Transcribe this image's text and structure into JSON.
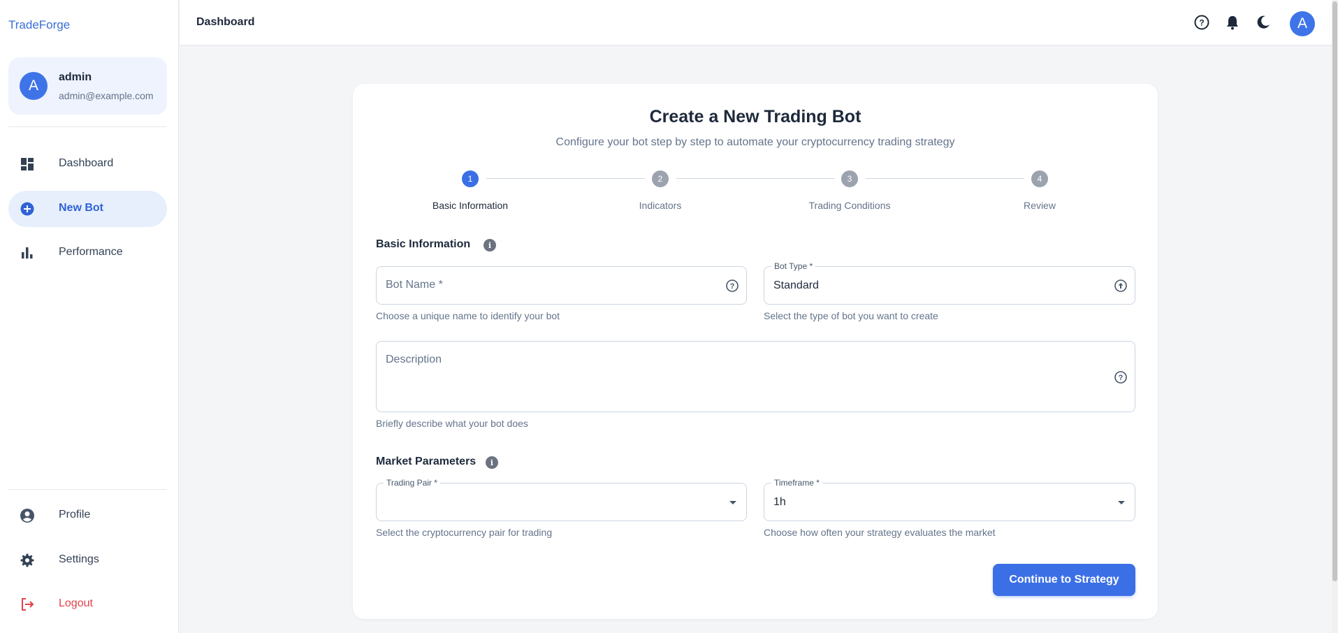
{
  "app": {
    "brand": "TradeForge"
  },
  "user": {
    "avatar_letter": "A",
    "name": "admin",
    "email": "admin@example.com"
  },
  "sidebar": {
    "items": [
      {
        "label": "Dashboard",
        "icon": "dashboard-icon"
      },
      {
        "label": "New Bot",
        "icon": "add-circle-icon",
        "active": true
      },
      {
        "label": "Performance",
        "icon": "bar-chart-icon"
      }
    ],
    "bottom_items": [
      {
        "label": "Profile",
        "icon": "account-circle-icon"
      },
      {
        "label": "Settings",
        "icon": "gear-icon"
      },
      {
        "label": "Logout",
        "icon": "logout-icon"
      }
    ]
  },
  "header": {
    "title": "Dashboard",
    "icons": [
      "help-icon",
      "bell-icon",
      "moon-icon"
    ],
    "avatar_letter": "A"
  },
  "wizard": {
    "title": "Create a New Trading Bot",
    "subtitle": "Configure your bot step by step to automate your cryptocurrency trading strategy",
    "steps": [
      {
        "number": "1",
        "label": "Basic Information",
        "active": true
      },
      {
        "number": "2",
        "label": "Indicators"
      },
      {
        "number": "3",
        "label": "Trading Conditions"
      },
      {
        "number": "4",
        "label": "Review"
      }
    ]
  },
  "basic_info": {
    "section_title": "Basic Information",
    "bot_name": {
      "placeholder": "Bot Name *",
      "value": "",
      "helper": "Choose a unique name to identify your bot"
    },
    "bot_type": {
      "label": "Bot Type *",
      "value": "Standard",
      "helper": "Select the type of bot you want to create"
    },
    "description": {
      "placeholder": "Description",
      "value": "",
      "helper": "Briefly describe what your bot does"
    }
  },
  "market": {
    "section_title": "Market Parameters",
    "trading_pair": {
      "label": "Trading Pair *",
      "value": "",
      "helper": "Select the cryptocurrency pair for trading"
    },
    "timeframe": {
      "label": "Timeframe *",
      "value": "1h",
      "helper": "Choose how often your strategy evaluates the market"
    }
  },
  "actions": {
    "continue_label": "Continue to Strategy"
  },
  "colors": {
    "accent": "#3b6fe6",
    "logout": "#e0424a",
    "background": "#f4f5f7"
  }
}
